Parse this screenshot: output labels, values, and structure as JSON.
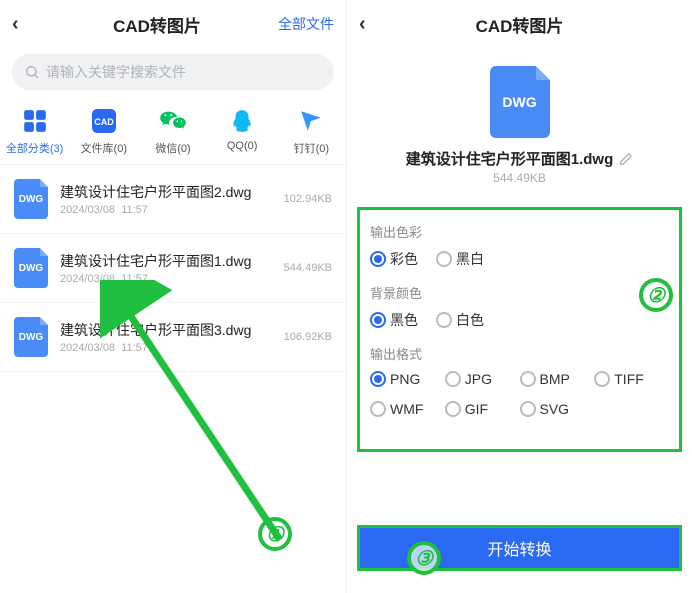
{
  "left": {
    "title": "CAD转图片",
    "header_action": "全部文件",
    "search_placeholder": "请输入关键字搜索文件",
    "categories": [
      {
        "label": "全部分类(3)",
        "active": true
      },
      {
        "label": "文件库(0)"
      },
      {
        "label": "微信(0)"
      },
      {
        "label": "QQ(0)"
      },
      {
        "label": "钉钉(0)"
      }
    ],
    "files": [
      {
        "ext": "DWG",
        "name": "建筑设计住宅户形平面图2.dwg",
        "date": "2024/03/08",
        "time": "11:57",
        "size": "102.94KB"
      },
      {
        "ext": "DWG",
        "name": "建筑设计住宅户形平面图1.dwg",
        "date": "2024/03/08",
        "time": "11:57",
        "size": "544.49KB"
      },
      {
        "ext": "DWG",
        "name": "建筑设计住宅户形平面图3.dwg",
        "date": "2024/03/08",
        "time": "11:57",
        "size": "106.92KB"
      }
    ]
  },
  "right": {
    "title": "CAD转图片",
    "file": {
      "ext": "DWG",
      "name": "建筑设计住宅户形平面图1.dwg",
      "size": "544.49KB"
    },
    "opt_color": {
      "title": "输出色彩",
      "options": [
        "彩色",
        "黑白"
      ],
      "selected": "彩色"
    },
    "opt_bg": {
      "title": "背景颜色",
      "options": [
        "黑色",
        "白色"
      ],
      "selected": "黑色"
    },
    "opt_fmt": {
      "title": "输出格式",
      "options": [
        "PNG",
        "JPG",
        "BMP",
        "TIFF",
        "WMF",
        "GIF",
        "SVG"
      ],
      "selected": "PNG"
    },
    "start_label": "开始转换"
  },
  "annotations": {
    "b1": "①",
    "b2": "②",
    "b3": "③"
  }
}
